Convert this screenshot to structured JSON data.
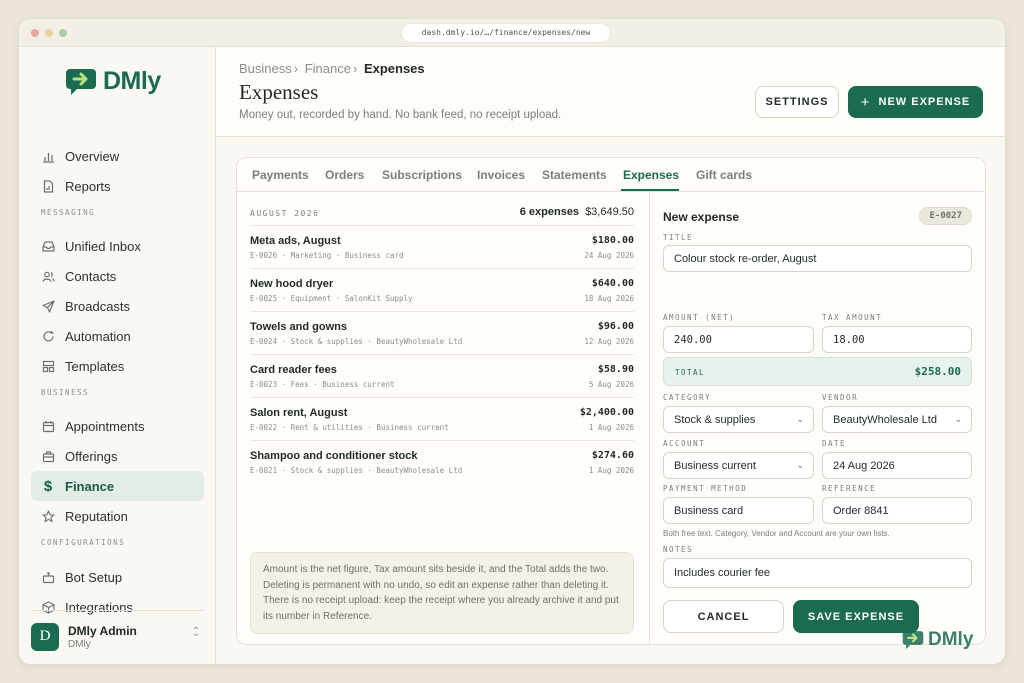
{
  "browser": {
    "url": "dash.dmly.io/…/finance/expenses/new"
  },
  "brand": {
    "name": "DMly"
  },
  "sidebar": {
    "items": [
      {
        "label": "Overview",
        "icon": "bar-chart-icon"
      },
      {
        "label": "Reports",
        "icon": "document-chart-icon"
      },
      {
        "label": "Unified Inbox",
        "icon": "inbox-icon"
      },
      {
        "label": "Contacts",
        "icon": "people-icon"
      },
      {
        "label": "Broadcasts",
        "icon": "send-icon"
      },
      {
        "label": "Automation",
        "icon": "refresh-icon"
      },
      {
        "label": "Templates",
        "icon": "layout-icon"
      },
      {
        "label": "Appointments",
        "icon": "calendar-icon"
      },
      {
        "label": "Offerings",
        "icon": "briefcase-icon"
      },
      {
        "label": "Finance",
        "icon": "dollar-icon"
      },
      {
        "label": "Reputation",
        "icon": "star-icon"
      },
      {
        "label": "Bot Setup",
        "icon": "bot-icon"
      },
      {
        "label": "Integrations",
        "icon": "cube-icon"
      }
    ],
    "sections": {
      "messaging": "MESSAGING",
      "business": "BUSINESS",
      "configurations": "CONFIGURATIONS"
    },
    "user": {
      "initial": "D",
      "name": "DMly Admin",
      "org": "DMly"
    }
  },
  "header": {
    "breadcrumb": [
      "Business",
      "Finance",
      "Expenses"
    ],
    "title": "Expenses",
    "subtitle": "Money out, recorded by hand. No bank feed, no receipt upload.",
    "settings_label": "SETTINGS",
    "new_label": "NEW EXPENSE"
  },
  "tabs": [
    "Payments",
    "Orders",
    "Subscriptions",
    "Invoices",
    "Statements",
    "Expenses",
    "Gift cards"
  ],
  "list": {
    "month": "AUGUST 2026",
    "count": "6 expenses",
    "total": "$3,649.50",
    "rows": [
      {
        "title": "Meta ads, August",
        "meta": "E-0026 · Marketing · Business card",
        "amount": "$180.00",
        "date": "24 Aug 2026"
      },
      {
        "title": "New hood dryer",
        "meta": "E-0025 · Equipment · SalonKit Supply",
        "amount": "$640.00",
        "date": "18 Aug 2026"
      },
      {
        "title": "Towels and gowns",
        "meta": "E-0024 · Stock & supplies · BeautyWholesale Ltd",
        "amount": "$96.00",
        "date": "12 Aug 2026"
      },
      {
        "title": "Card reader fees",
        "meta": "E-0023 · Fees · Business current",
        "amount": "$58.90",
        "date": "5 Aug 2026"
      },
      {
        "title": "Salon rent, August",
        "meta": "E-0022 · Rent & utilities · Business current",
        "amount": "$2,400.00",
        "date": "1 Aug 2026"
      },
      {
        "title": "Shampoo and conditioner stock",
        "meta": "E-0021 · Stock & supplies · BeautyWholesale Ltd",
        "amount": "$274.60",
        "date": "1 Aug 2026"
      }
    ],
    "note": "Amount is the net figure, Tax amount sits beside it, and the Total adds the two. Deleting is permanent with no undo, so edit an expense rather than deleting it. There is no receipt upload: keep the receipt where you already archive it and put its number in Reference."
  },
  "form": {
    "title": "New expense",
    "badge": "E-0027",
    "title_label": "TITLE",
    "title_value": "Colour stock re-order, August",
    "amount_label": "AMOUNT (NET)",
    "amount_value": "240.00",
    "tax_label": "TAX AMOUNT",
    "tax_value": "18.00",
    "total_label": "TOTAL",
    "total_value": "$258.00",
    "category_label": "CATEGORY",
    "category_value": "Stock & supplies",
    "vendor_label": "VENDOR",
    "vendor_value": "BeautyWholesale Ltd",
    "account_label": "ACCOUNT",
    "account_value": "Business current",
    "date_label": "DATE",
    "date_value": "24 Aug 2026",
    "payment_label": "PAYMENT METHOD",
    "payment_value": "Business card",
    "reference_label": "REFERENCE",
    "reference_value": "Order 8841",
    "hint": "Both free text. Category, Vendor and Account are your own lists.",
    "notes_label": "NOTES",
    "notes_value": "Includes courier fee",
    "cancel_label": "CANCEL",
    "save_label": "SAVE EXPENSE"
  },
  "colors": {
    "accent": "#1a6b52",
    "background": "#ece6d9"
  }
}
